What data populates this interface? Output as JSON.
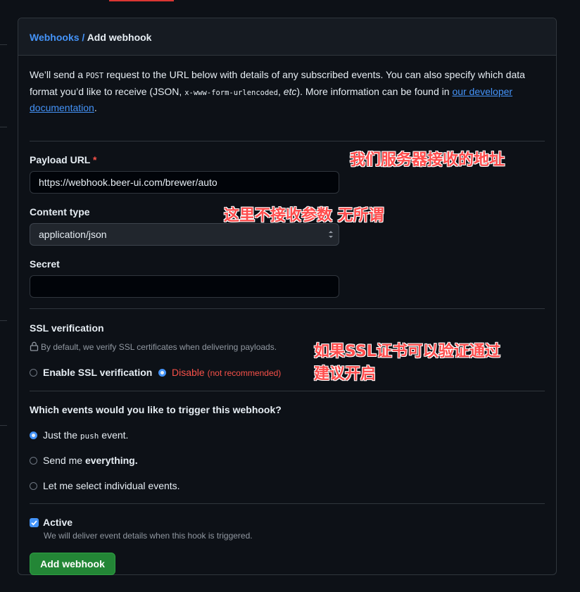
{
  "breadcrumb": {
    "parent": "Webhooks",
    "separator": " / ",
    "current": "Add webhook"
  },
  "intro": {
    "t1": "We’ll send a ",
    "code1": "POST",
    "t2": " request to the URL below with details of any subscribed events. You can also specify which data format you’d like to receive (JSON, ",
    "code2": "x-www-form-urlencoded",
    "t3": ", ",
    "em": "etc",
    "t4": "). More information can be found in ",
    "link": "our developer documentation",
    "t5": "."
  },
  "payload_url": {
    "label": "Payload URL",
    "required_mark": "*",
    "value": "https://webhook.beer-ui.com/brewer/auto"
  },
  "content_type": {
    "label": "Content type",
    "selected": "application/json"
  },
  "secret": {
    "label": "Secret",
    "value": ""
  },
  "ssl": {
    "label": "SSL verification",
    "note": "By default, we verify SSL certificates when delivering payloads.",
    "enable_label": "Enable SSL verification",
    "disable_label": "Disable",
    "disable_note": "(not recommended)"
  },
  "events": {
    "question": "Which events would you like to trigger this webhook?",
    "opt1_a": "Just the ",
    "opt1_code": "push",
    "opt1_b": " event.",
    "opt2_a": "Send me ",
    "opt2_b": "everything.",
    "opt3": "Let me select individual events."
  },
  "active": {
    "label": "Active",
    "note": "We will deliver event details when this hook is triggered.",
    "checked": true
  },
  "submit_label": "Add webhook",
  "annotations": {
    "a1": "我们服务器接收的地址",
    "a2": "这里不接收参数 无所谓",
    "a3_line1": "如果SSL证书可以验证通过",
    "a3_line2": "建议开启"
  },
  "colors": {
    "accent": "#4493f8",
    "danger": "#f85149",
    "primary_button": "#238636",
    "annotation": "#ff4d4d"
  },
  "icons": {
    "lock": "lock-icon",
    "select_arrows": "select-arrows-icon",
    "check": "check-icon"
  }
}
